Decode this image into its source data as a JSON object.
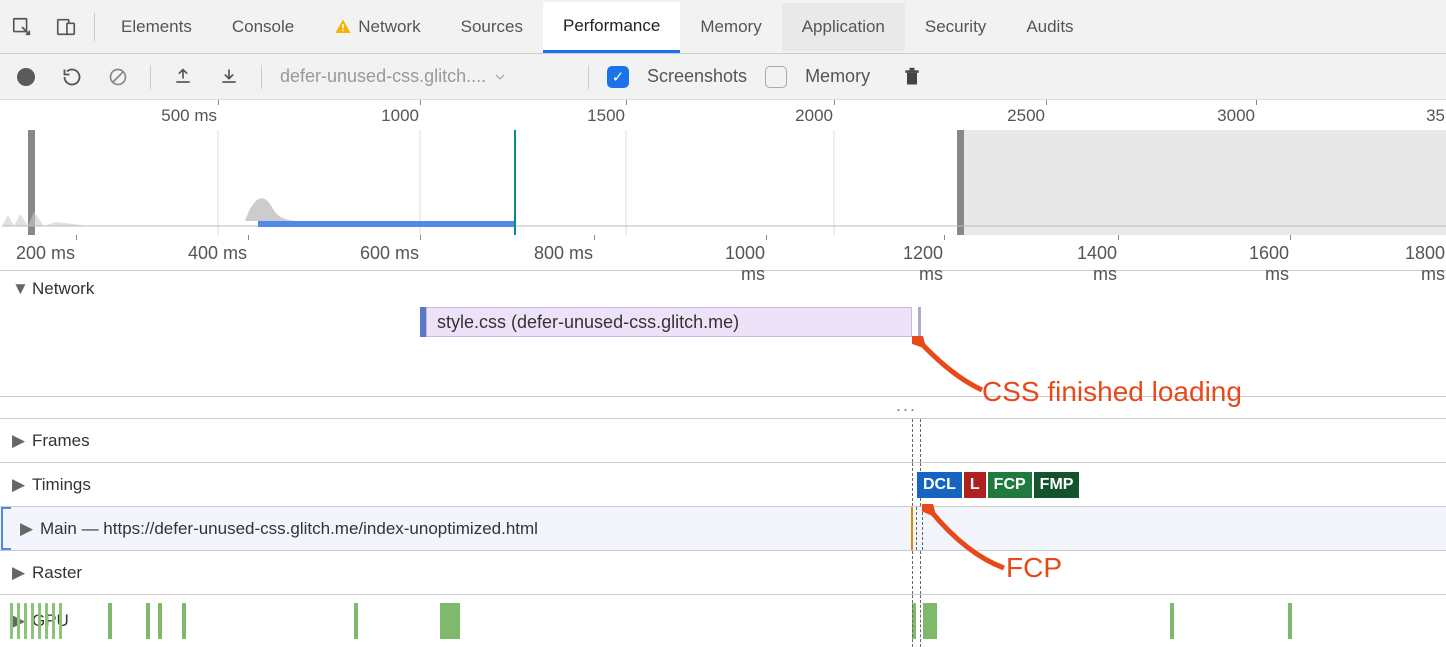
{
  "tabs": {
    "elements": "Elements",
    "console": "Console",
    "network": "Network",
    "sources": "Sources",
    "performance": "Performance",
    "memory": "Memory",
    "application": "Application",
    "security": "Security",
    "audits": "Audits",
    "active": "Performance"
  },
  "toolbar": {
    "url": "defer-unused-css.glitch....",
    "screenshots_label": "Screenshots",
    "screenshots_checked": true,
    "memory_label": "Memory",
    "memory_checked": false
  },
  "overview_ticks": [
    "500 ms",
    "1000 ms",
    "1500 ms",
    "2000 ms",
    "2500 ms",
    "3000 ms",
    "35"
  ],
  "detail_ticks": [
    "200 ms",
    "400 ms",
    "600 ms",
    "800 ms",
    "1000 ms",
    "1200 ms",
    "1400 ms",
    "1600 ms",
    "1800 ms"
  ],
  "tracks": {
    "network": "Network",
    "frames": "Frames",
    "timings": "Timings",
    "main": "Main — https://defer-unused-css.glitch.me/index-unoptimized.html",
    "raster": "Raster",
    "gpu": "GPU"
  },
  "network_request": "style.css (defer-unused-css.glitch.me)",
  "timing_badges": {
    "dcl": "DCL",
    "l": "L",
    "fcp": "FCP",
    "fmp": "FMP"
  },
  "annotations": {
    "css_finished": "CSS finished loading",
    "fcp": "FCP"
  }
}
